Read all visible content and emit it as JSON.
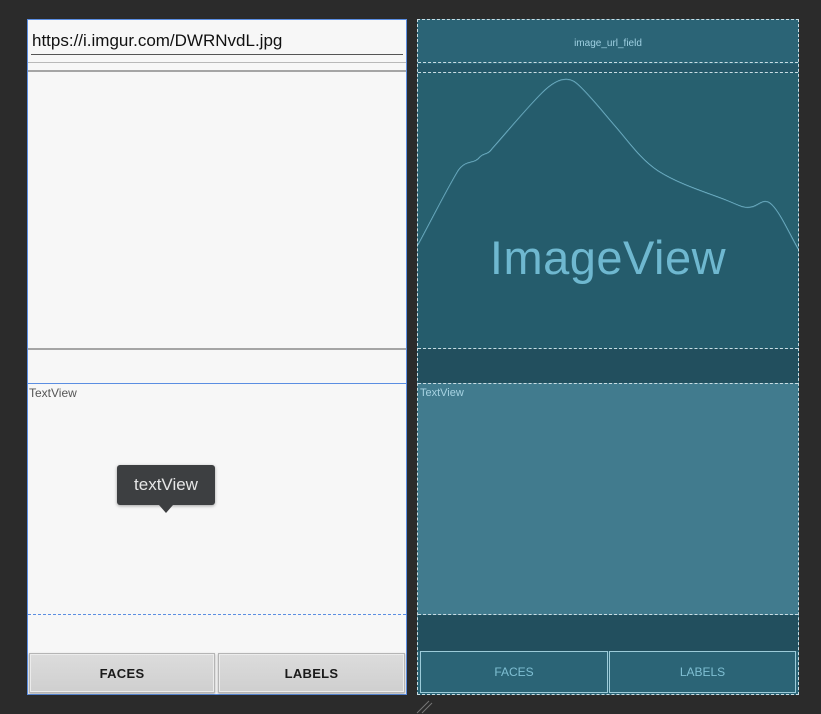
{
  "design": {
    "url_value": "https://i.imgur.com/DWRNvdL.jpg",
    "textview_label": "TextView",
    "tooltip": "textView",
    "buttons": {
      "faces": "FACES",
      "labels": "LABELS"
    }
  },
  "blueprint": {
    "url_field_id": "image_url_field",
    "image_label": "ImageView",
    "textview_label": "TextView",
    "buttons": {
      "faces": "FACES",
      "labels": "LABELS"
    }
  },
  "colors": {
    "canvas_bg": "#2b2b2b",
    "design_bg": "#f7f7f7",
    "selection_blue": "#5b8ee2",
    "blueprint_bg": "#2b6476",
    "blueprint_text_bg": "#417b8e",
    "blueprint_accent": "#6fb8d0"
  }
}
